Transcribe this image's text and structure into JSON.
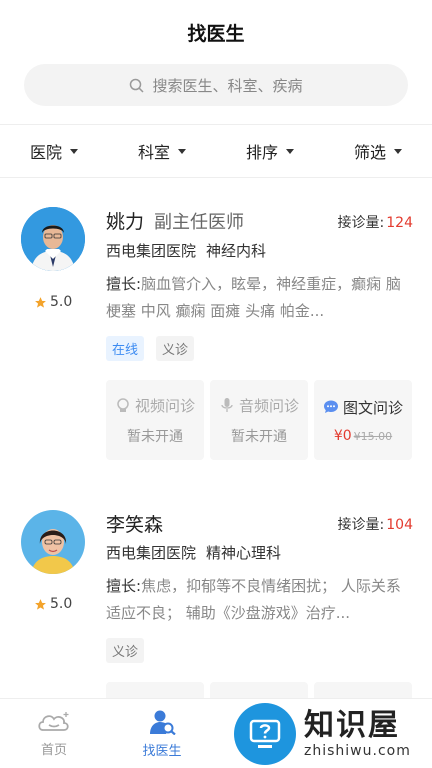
{
  "header": {
    "title": "找医生"
  },
  "search": {
    "placeholder": "搜索医生、科室、疾病"
  },
  "filters": [
    "医院",
    "科室",
    "排序",
    "筛选"
  ],
  "doctors": [
    {
      "name": "姚力",
      "title": "副主任医师",
      "consult_label": "接诊量:",
      "consult_count": "124",
      "hospital": "西电集团医院",
      "department": "神经内科",
      "rating": "5.0",
      "specialty_label": "擅长:",
      "specialty": "脑血管介入，眩晕，神经重症，癫痫 脑梗塞 中风 癫痫 面瘫 头痛 帕金...",
      "tags": [
        "在线",
        "义诊"
      ],
      "services": [
        {
          "name": "视频问诊",
          "status": "暂未开通"
        },
        {
          "name": "音频问诊",
          "status": "暂未开通"
        },
        {
          "name": "图文问诊",
          "price": "¥0",
          "old_price": "¥15.00"
        }
      ]
    },
    {
      "name": "李笑森",
      "title": "",
      "consult_label": "接诊量:",
      "consult_count": "104",
      "hospital": "西电集团医院",
      "department": "精神心理科",
      "rating": "5.0",
      "specialty_label": "擅长:",
      "specialty": "焦虑，抑郁等不良情绪困扰； 人际关系适应不良； 辅助《沙盘游戏》治疗...",
      "tags": [
        "义诊"
      ]
    }
  ],
  "tabbar": [
    "首页",
    "找医生"
  ],
  "watermark": {
    "big": "知识屋",
    "small": "zhishiwu.com"
  },
  "colors": {
    "accent": "#3b7bd8",
    "price": "#e33b2f",
    "star": "#f3a32b"
  }
}
